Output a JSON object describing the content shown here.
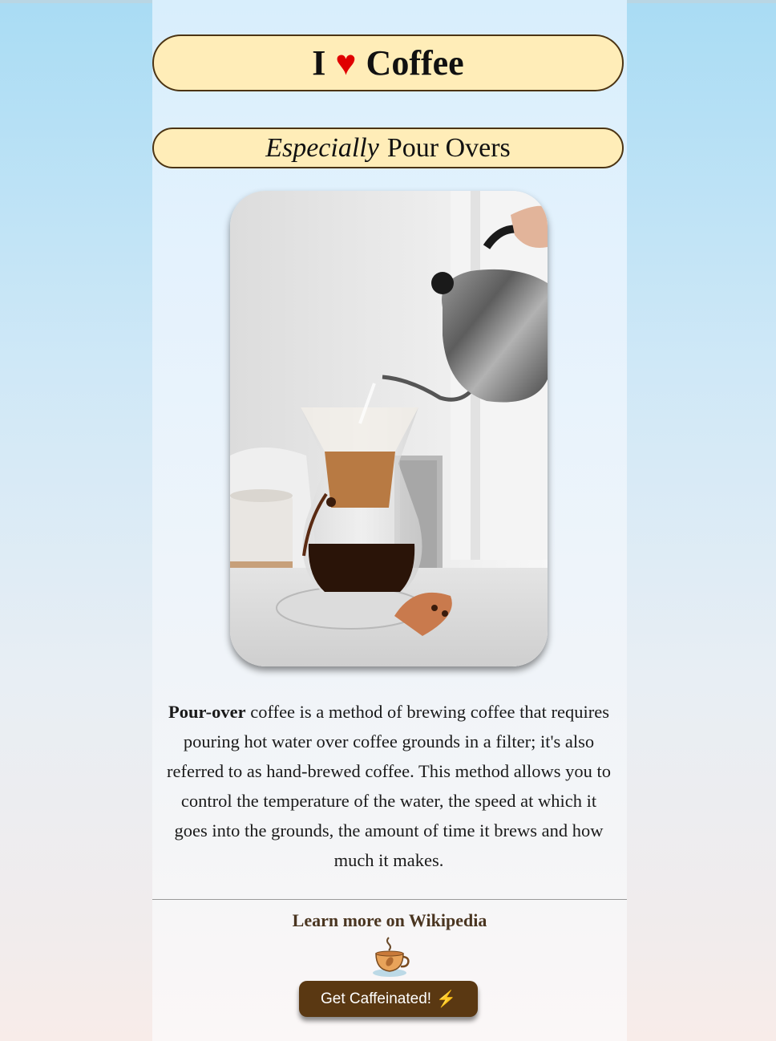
{
  "header": {
    "title_left": "I",
    "heart_icon": "♥",
    "title_right": "Coffee",
    "heart_color": "#e00000"
  },
  "subtitle": {
    "emphasis": "Especially",
    "rest": "Pour Overs"
  },
  "hero_image": {
    "icon": "pour-over-coffee-photo"
  },
  "description": {
    "bold": "Pour-over",
    "text": " coffee is a method of brewing coffee that requires pouring hot water over coffee grounds in a filter; it's also referred to as hand-brewed coffee. This method allows you to control the temperature of the water, the speed at which it goes into the grounds, the amount of time it brews and how much it makes."
  },
  "links": {
    "wikipedia": "Learn more on Wikipedia"
  },
  "cta": {
    "label": "Get Caffeinated!",
    "icon": "⚡",
    "color": "#5a3812"
  },
  "colors": {
    "pill_bg": "#ffedb8",
    "pill_border": "#4b3413"
  }
}
